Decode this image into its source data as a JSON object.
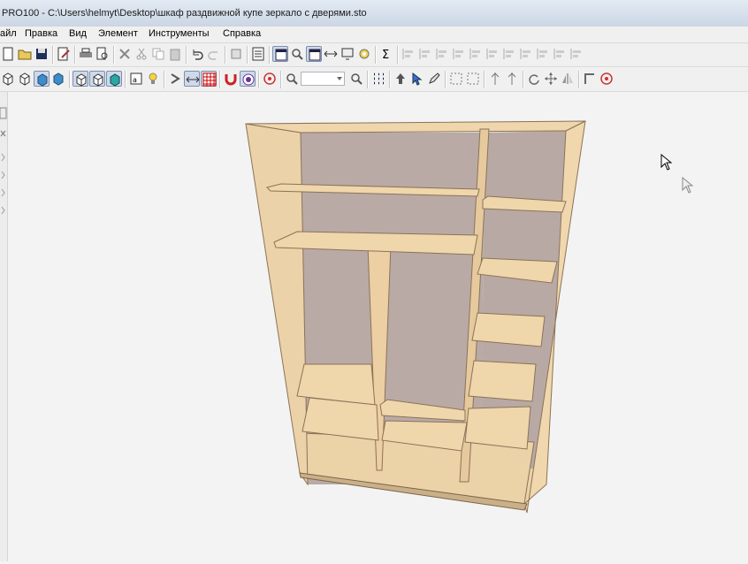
{
  "window": {
    "title": "PRO100 - C:\\Users\\helmyt\\Desktop\\шкаф раздвижной купе зеркало с дверями.sto"
  },
  "menu": [
    {
      "label": "айл",
      "name": "menu-file"
    },
    {
      "label": "Правка",
      "name": "menu-edit"
    },
    {
      "label": "Вид",
      "name": "menu-view"
    },
    {
      "label": "Элемент",
      "name": "menu-element"
    },
    {
      "label": "Инструменты",
      "name": "menu-tools"
    },
    {
      "label": "Справка",
      "name": "menu-help"
    }
  ],
  "toolbar1": {
    "buttons": [
      {
        "name": "new-file-icon",
        "icon": "page"
      },
      {
        "name": "open-folder-icon",
        "icon": "folder"
      },
      {
        "name": "save-icon",
        "icon": "disk"
      },
      {
        "name": "sep"
      },
      {
        "name": "properties-icon",
        "icon": "pencil-page"
      },
      {
        "name": "sep"
      },
      {
        "name": "print-icon",
        "icon": "printer"
      },
      {
        "name": "print-preview-icon",
        "icon": "magnifier-page"
      },
      {
        "name": "sep"
      },
      {
        "name": "delete-icon",
        "icon": "cross"
      },
      {
        "name": "cut-icon",
        "icon": "scissors"
      },
      {
        "name": "copy-icon",
        "icon": "copy"
      },
      {
        "name": "paste-icon",
        "icon": "paste"
      },
      {
        "name": "sep"
      },
      {
        "name": "undo-icon",
        "icon": "undo"
      },
      {
        "name": "redo-icon",
        "icon": "redo"
      },
      {
        "name": "sep"
      },
      {
        "name": "library-icon",
        "icon": "box"
      },
      {
        "name": "sep"
      },
      {
        "name": "checklist-icon",
        "icon": "checklist"
      },
      {
        "name": "sep"
      },
      {
        "name": "view-mode-icon",
        "icon": "window",
        "pressed": true
      },
      {
        "name": "zoom-window-icon",
        "icon": "magnifier"
      },
      {
        "name": "fit-view-icon",
        "icon": "window",
        "pressed": true
      },
      {
        "name": "dimension-icon",
        "icon": "arrows-h"
      },
      {
        "name": "render-icon",
        "icon": "screen"
      },
      {
        "name": "settings-icon",
        "icon": "gear"
      },
      {
        "name": "sep"
      },
      {
        "name": "sum-icon",
        "icon": "sigma"
      },
      {
        "name": "sep"
      },
      {
        "name": "align-left-icon",
        "icon": "align"
      },
      {
        "name": "align-right-icon",
        "icon": "align"
      },
      {
        "name": "align-top-icon",
        "icon": "align"
      },
      {
        "name": "align-bottom-icon",
        "icon": "align"
      },
      {
        "name": "align-center-icon",
        "icon": "align"
      },
      {
        "name": "align-middle-icon",
        "icon": "align"
      },
      {
        "name": "distribute-h-icon",
        "icon": "align"
      },
      {
        "name": "distribute-v-icon",
        "icon": "align"
      },
      {
        "name": "align-front-icon",
        "icon": "align"
      },
      {
        "name": "align-back-icon",
        "icon": "align"
      },
      {
        "name": "align-depth-icon",
        "icon": "align"
      }
    ]
  },
  "toolbar2": {
    "buttons": [
      {
        "name": "wireframe-icon",
        "icon": "cube"
      },
      {
        "name": "hidden-lines-icon",
        "icon": "cube"
      },
      {
        "name": "shaded-icon",
        "icon": "cube-blue",
        "pressed": true
      },
      {
        "name": "textured-icon",
        "icon": "cube-blue"
      },
      {
        "name": "sep"
      },
      {
        "name": "view-front-icon",
        "icon": "cube",
        "pressed": true
      },
      {
        "name": "view-side-icon",
        "icon": "cube",
        "pressed": true
      },
      {
        "name": "view-persp-icon",
        "icon": "cube-teal",
        "pressed": true
      },
      {
        "name": "sep"
      },
      {
        "name": "labels-icon",
        "icon": "text",
        "pressed": false
      },
      {
        "name": "light-icon",
        "icon": "bulb"
      },
      {
        "name": "sep"
      },
      {
        "name": "snap-icon",
        "icon": "magnet-s"
      },
      {
        "name": "dimensions-toggle-icon",
        "icon": "arrows-h",
        "pressed": true
      },
      {
        "name": "grid-icon",
        "icon": "grid",
        "pressed": true
      },
      {
        "name": "sep"
      },
      {
        "name": "magnet-icon",
        "icon": "magnet"
      },
      {
        "name": "snap-center-icon",
        "icon": "target-purple",
        "pressed": true
      },
      {
        "name": "sep"
      },
      {
        "name": "target-icon",
        "icon": "target"
      },
      {
        "name": "sep"
      },
      {
        "name": "zoom-in-icon",
        "icon": "magnifier"
      },
      {
        "name": "zoom-combo",
        "icon": "combo"
      },
      {
        "name": "zoom-out-icon",
        "icon": "magnifier"
      },
      {
        "name": "sep"
      },
      {
        "name": "select-grid-icon",
        "icon": "dots"
      },
      {
        "name": "sep"
      },
      {
        "name": "move-up-icon",
        "icon": "arrow-up"
      },
      {
        "name": "move-cursor-icon",
        "icon": "cursor-blue"
      },
      {
        "name": "edit-element-icon",
        "icon": "pencil"
      },
      {
        "name": "sep"
      },
      {
        "name": "group-icon",
        "icon": "square-dash"
      },
      {
        "name": "ungroup-icon",
        "icon": "square-dash"
      },
      {
        "name": "sep"
      },
      {
        "name": "rotate-icon",
        "icon": "pin"
      },
      {
        "name": "rotate-2-icon",
        "icon": "pin"
      },
      {
        "name": "sep"
      },
      {
        "name": "refresh-icon",
        "icon": "circle-arrow"
      },
      {
        "name": "move-icon",
        "icon": "cross-arrows"
      },
      {
        "name": "mirror-icon",
        "icon": "mirror"
      },
      {
        "name": "sep"
      },
      {
        "name": "corner-icon",
        "icon": "corner"
      },
      {
        "name": "snap-target-icon",
        "icon": "target"
      }
    ]
  }
}
